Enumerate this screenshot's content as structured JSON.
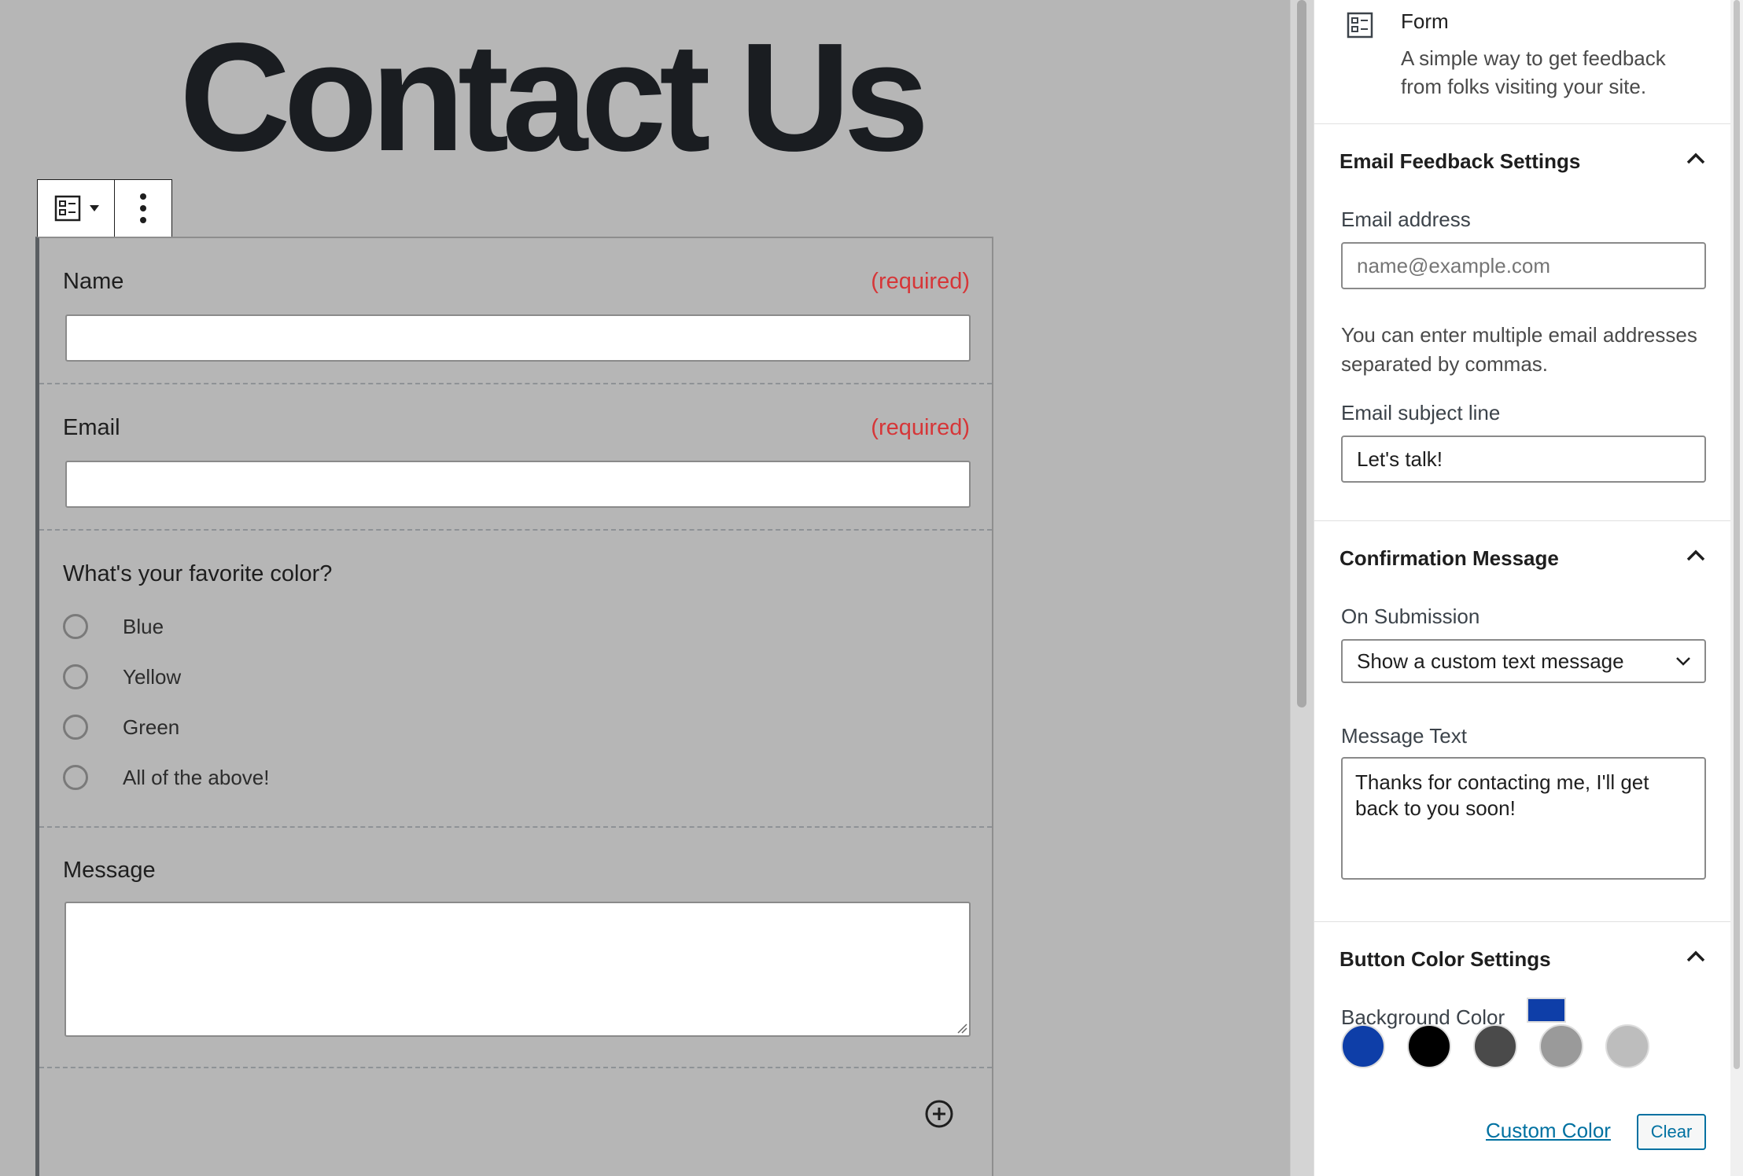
{
  "page": {
    "title": "Contact Us"
  },
  "block_toolbar": {
    "switcher_icon": "form-icon",
    "more_icon": "more-vertical-icon"
  },
  "form": {
    "name_label": "Name",
    "name_required": "(required)",
    "email_label": "Email",
    "email_required": "(required)",
    "color_question": "What's your favorite color?",
    "color_options": [
      "Blue",
      "Yellow",
      "Green",
      "All of the above!"
    ],
    "message_label": "Message"
  },
  "sidebar": {
    "block_card": {
      "title": "Form",
      "description": "A simple way to get feedback from folks visiting your site.",
      "icon": "form-icon"
    },
    "email_panel": {
      "title": "Email Feedback Settings",
      "email_label": "Email address",
      "email_placeholder": "name@example.com",
      "email_help": "You can enter multiple email addresses separated by commas.",
      "subject_label": "Email subject line",
      "subject_value": "Let's talk!"
    },
    "confirm_panel": {
      "title": "Confirmation Message",
      "submission_label": "On Submission",
      "submission_value": "Show a custom text message",
      "message_label": "Message Text",
      "message_value": "Thanks for contacting me, I'll get back to you soon!"
    },
    "button_panel": {
      "title": "Button Color Settings",
      "bg_label": "Background Color",
      "selected_color": "#0e3ea8",
      "swatches": [
        "#0e3ea8",
        "#000000",
        "#4a4a4a",
        "#9a9a9a",
        "#bdbdbd"
      ],
      "custom_color_label": "Custom Color",
      "clear_label": "Clear"
    }
  }
}
